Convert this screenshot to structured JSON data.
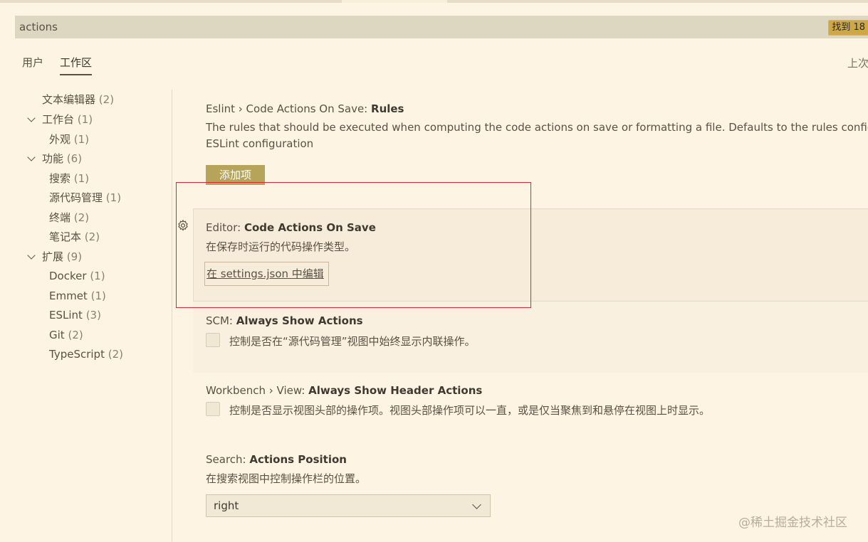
{
  "search": {
    "value": "actions",
    "result_badge": "找到 18"
  },
  "scope_tabs": [
    {
      "label": "用户"
    },
    {
      "label": "工作区"
    }
  ],
  "header_right": "上次",
  "toc": [
    {
      "label": "文本编辑器",
      "count": "(2)"
    },
    {
      "label": "工作台",
      "count": "(1)"
    },
    {
      "label": "外观",
      "count": "(1)"
    },
    {
      "label": "功能",
      "count": "(6)"
    },
    {
      "label": "搜索",
      "count": "(1)"
    },
    {
      "label": "源代码管理",
      "count": "(1)"
    },
    {
      "label": "终端",
      "count": "(2)"
    },
    {
      "label": "笔记本",
      "count": "(2)"
    },
    {
      "label": "扩展",
      "count": "(9)"
    },
    {
      "label": "Docker",
      "count": "(1)"
    },
    {
      "label": "Emmet",
      "count": "(1)"
    },
    {
      "label": "ESLint",
      "count": "(3)"
    },
    {
      "label": "Git",
      "count": "(2)"
    },
    {
      "label": "TypeScript",
      "count": "(2)"
    }
  ],
  "settings": {
    "eslint_rules": {
      "category": "Eslint › Code Actions On Save: ",
      "name": "Rules",
      "desc_line1": "The rules that should be executed when computing the code actions on save or formatting a file. Defaults to the rules configured v",
      "desc_line2": "ESLint configuration",
      "add_button": "添加项"
    },
    "editor_code_actions": {
      "category": "Editor: ",
      "name": "Code Actions On Save",
      "desc": "在保存时运行的代码操作类型。",
      "edit_link": "在 settings.json 中编辑"
    },
    "scm_actions": {
      "category": "SCM: ",
      "name": "Always Show Actions",
      "desc": "控制是否在“源代码管理”视图中始终显示内联操作。",
      "checked": false
    },
    "workbench_header": {
      "category": "Workbench › View: ",
      "name": "Always Show Header Actions",
      "desc": "控制是否显示视图头部的操作项。视图头部操作项可以一直，或是仅当聚焦到和悬停在视图上时显示。",
      "checked": false
    },
    "search_position": {
      "category": "Search: ",
      "name": "Actions Position",
      "desc": "在搜索视图中控制操作栏的位置。",
      "value": "right"
    }
  },
  "watermark": "@稀土掘金技术社区"
}
